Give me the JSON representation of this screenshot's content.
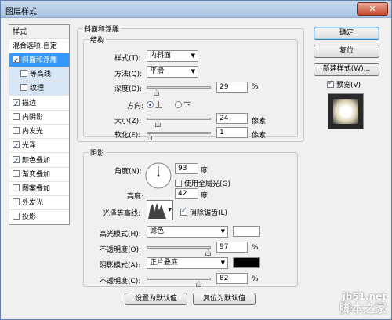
{
  "window": {
    "title": "图层样式",
    "close_glyph": "✕"
  },
  "left_list": {
    "header": "样式",
    "blend_options": "混合选项:自定",
    "items": [
      {
        "label": "斜面和浮雕",
        "checked": true,
        "selected": true
      },
      {
        "label": "等高线",
        "checked": false,
        "sub": true
      },
      {
        "label": "纹理",
        "checked": false,
        "sub": true
      },
      {
        "label": "描边",
        "checked": true
      },
      {
        "label": "内阴影",
        "checked": false
      },
      {
        "label": "内发光",
        "checked": false
      },
      {
        "label": "光泽",
        "checked": true
      },
      {
        "label": "颜色叠加",
        "checked": true
      },
      {
        "label": "渐变叠加",
        "checked": false
      },
      {
        "label": "图案叠加",
        "checked": false
      },
      {
        "label": "外发光",
        "checked": false
      },
      {
        "label": "投影",
        "checked": false
      }
    ]
  },
  "bevel": {
    "section_title": "斜面和浮雕",
    "structure_title": "结构",
    "style_label": "样式(T):",
    "style_value": "内斜面",
    "method_label": "方法(Q):",
    "method_value": "平滑",
    "depth_label": "深度(D):",
    "depth_value": "29",
    "depth_unit": "%",
    "direction_label": "方向:",
    "direction_up": "上",
    "direction_down": "下",
    "size_label": "大小(Z):",
    "size_value": "24",
    "size_unit": "像素",
    "soften_label": "软化(F):",
    "soften_value": "1",
    "soften_unit": "像素"
  },
  "shading": {
    "title": "阴影",
    "angle_label": "角度(N):",
    "angle_value": "93",
    "angle_unit": "度",
    "global_light_label": "使用全局光(G)",
    "altitude_label": "高度:",
    "altitude_value": "42",
    "altitude_unit": "度",
    "gloss_label": "光泽等高线:",
    "antialias_label": "消除锯齿(L)",
    "highlight_mode_label": "高光模式(H):",
    "highlight_mode_value": "滤色",
    "highlight_color": "#ffffff",
    "highlight_opacity_label": "不透明度(O):",
    "highlight_opacity_value": "97",
    "highlight_opacity_unit": "%",
    "shadow_mode_label": "阴影模式(A):",
    "shadow_mode_value": "正片叠底",
    "shadow_color": "#000000",
    "shadow_opacity_label": "不透明度(C):",
    "shadow_opacity_value": "82",
    "shadow_opacity_unit": "%"
  },
  "footer": {
    "set_default": "设置为默认值",
    "reset_default": "复位为默认值"
  },
  "right": {
    "ok": "确定",
    "reset": "复位",
    "new_style": "新建样式(W)...",
    "preview_label": "预览(V)"
  },
  "watermark": {
    "line1": "jb51.net",
    "line2": "脚本之家"
  }
}
